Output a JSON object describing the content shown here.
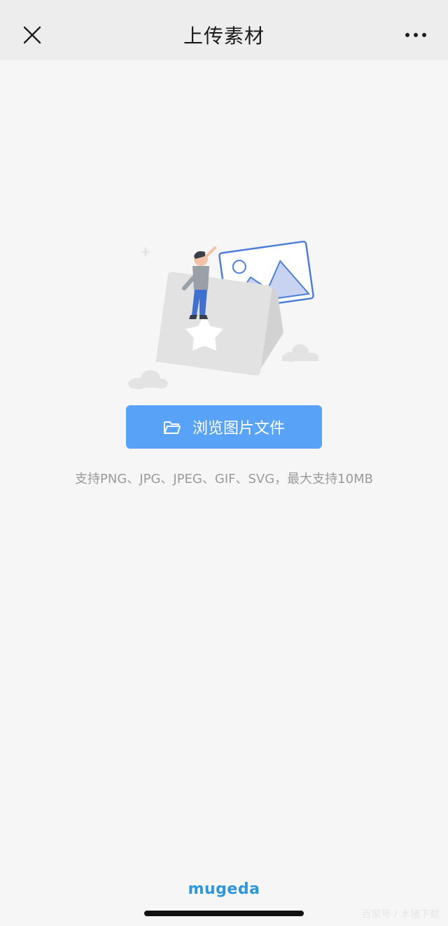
{
  "header": {
    "title": "上传素材",
    "close_icon": "close-icon",
    "more_icon": "more-icon"
  },
  "main": {
    "illustration_icon": "upload-illustration",
    "browse_button_label": "浏览图片文件",
    "browse_button_icon": "folder-icon",
    "hint": "支持PNG、JPG、JPEG、GIF、SVG，最大支持10MB"
  },
  "footer": {
    "brand": "mugeda",
    "watermark": "百家号 / 木猪下载"
  },
  "colors": {
    "header_bg": "#ededed",
    "page_bg": "#f6f6f6",
    "accent": "#58a3f7",
    "brand": "#2f96d8"
  }
}
